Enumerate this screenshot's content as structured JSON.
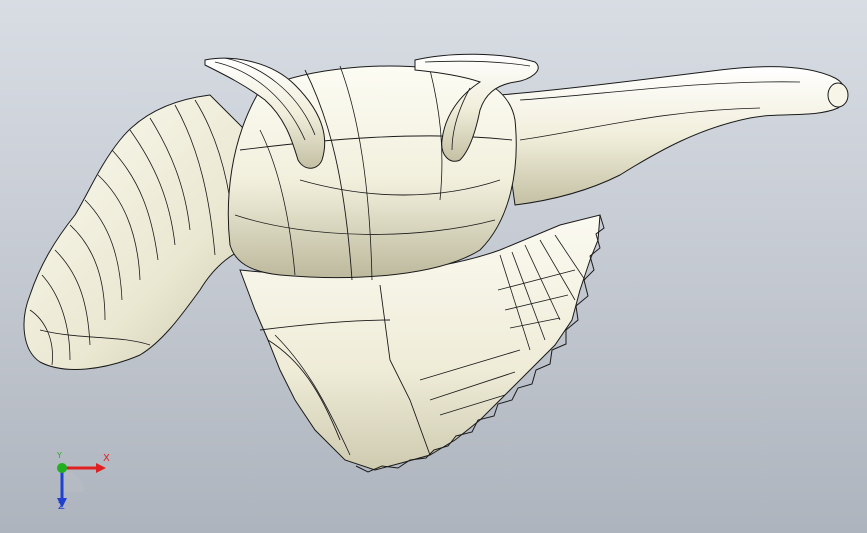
{
  "viewport": {
    "background_top": "#d8dde4",
    "background_bottom": "#aeb4bd"
  },
  "model": {
    "surface_color": "#f4f2e3",
    "shade_color": "#c9c6ad",
    "edge_color": "#1a1a1a"
  },
  "triad": {
    "x_label": "X",
    "y_label": "Y",
    "z_label": "Z",
    "x_color": "#e02020",
    "y_color": "#20b020",
    "z_color": "#2040d0"
  }
}
